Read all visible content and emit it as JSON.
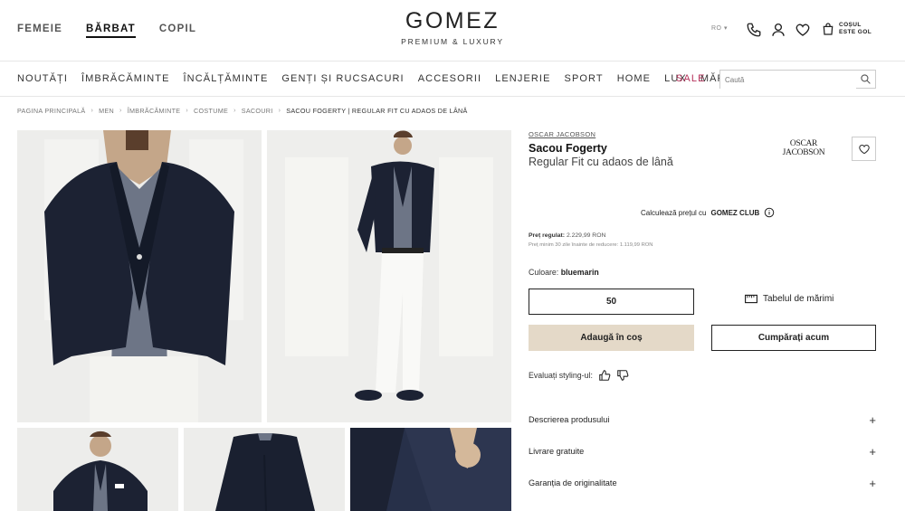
{
  "header": {
    "gender_tabs": [
      "FEMEIE",
      "BĂRBAT",
      "COPIL"
    ],
    "logo_name": "GOMEZ",
    "logo_tagline": "PREMIUM & LUXURY",
    "lang": "RO ▾",
    "cart_line1": "COȘUL",
    "cart_line2": "ESTE GOL"
  },
  "nav": {
    "items": [
      "NOUTĂȚI",
      "ÎMBRĂCĂMINTE",
      "ÎNCĂLȚĂMINTE",
      "GENȚI ȘI RUCSACURI",
      "ACCESORII",
      "LENJERIE",
      "SPORT",
      "HOME",
      "LUX",
      "MĂRCI"
    ],
    "sale": "SALE",
    "search_placeholder": "Caută"
  },
  "breadcrumb": [
    "PAGINA PRINCIPALĂ",
    "MEN",
    "ÎMBRĂCĂMINTE",
    "COSTUME",
    "SACOURI",
    "SACOU FOGERTY | REGULAR FIT CU ADAOS DE LÂNĂ"
  ],
  "product": {
    "brand": "OSCAR JACOBSON",
    "brand_logo_line1": "OSCAR",
    "brand_logo_line2": "JACOBSON",
    "name": "Sacou Fogerty",
    "subtitle": "Regular Fit cu adaos de lână",
    "club_text": "Calculează prețul cu",
    "club_name": "GOMEZ CLUB",
    "price_label": "Preț regulat:",
    "price_value": "2.229,99 RON",
    "price_min": "Preț minim 30 zile înainte de reducere: 1.119,99 RON",
    "color_label": "Culoare:",
    "color_value": "bluemarin",
    "size": "50",
    "size_table": "Tabelul de mărimi",
    "add_to_cart": "Adaugă în coș",
    "buy_now": "Cumpărați acum",
    "rate_label": "Evaluați styling-ul:",
    "accordion": [
      "Descrierea produsului",
      "Livrare gratuite",
      "Garanția de originalitate"
    ]
  },
  "colors": {
    "sale": "#b5315a",
    "add_to_cart_bg": "#e4d9c8",
    "jacket": "#1c2233"
  }
}
